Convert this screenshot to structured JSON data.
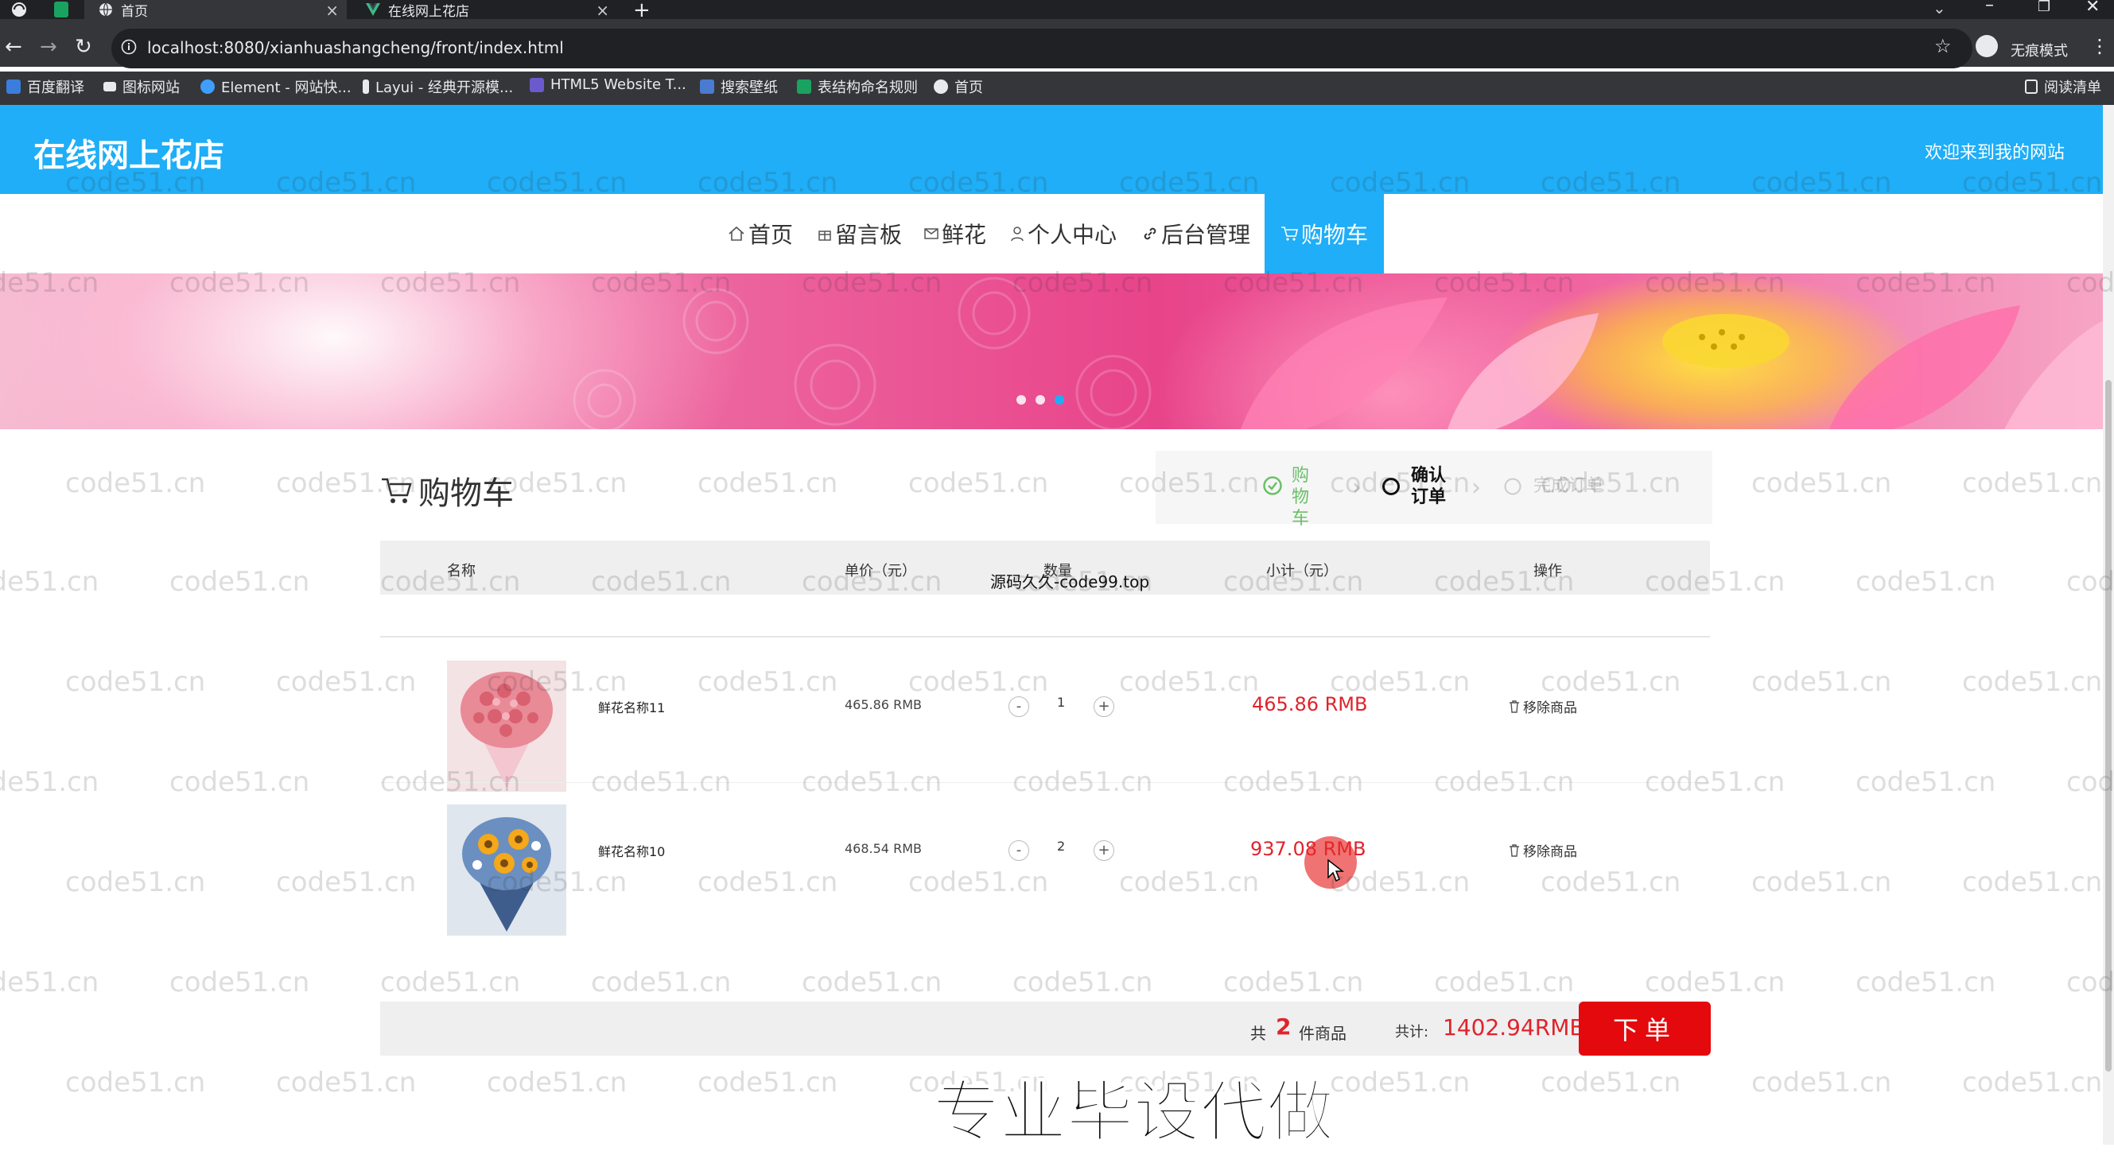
{
  "browser": {
    "tabs": [
      {
        "label": "首页",
        "icon": "globe-icon"
      },
      {
        "label": "在线网上花店",
        "icon": "vue-logo-icon"
      }
    ],
    "new_tab": "+",
    "url": "localhost:8080/xianhuashangcheng/front/index.html",
    "profile_label": "无痕模式",
    "bookmarks": [
      "百度翻译",
      "图标网站",
      "Element - 网站快...",
      "Layui - 经典开源模...",
      "HTML5 Website T...",
      "搜索壁纸",
      "表结构命名规则",
      "首页"
    ],
    "reading_list": "阅读清单",
    "colors": {
      "titlebar": "#202124",
      "toolbar": "#35363a"
    }
  },
  "site": {
    "title": "在线网上花店",
    "welcome": "欢迎来到我的网站",
    "accent_color": "#1faef7"
  },
  "nav": [
    {
      "label": "首页",
      "icon": "home-icon",
      "active": false
    },
    {
      "label": "留言板",
      "icon": "gift-icon",
      "active": false
    },
    {
      "label": "鲜花",
      "icon": "mail-icon",
      "active": false
    },
    {
      "label": "个人中心",
      "icon": "user-icon",
      "active": false
    },
    {
      "label": "后台管理",
      "icon": "link-icon",
      "active": false
    },
    {
      "label": "购物车",
      "icon": "cart-icon",
      "active": true
    }
  ],
  "banner": {
    "slide_count": 3,
    "active_slide": 3
  },
  "cart": {
    "title": "购物车",
    "steps": [
      {
        "label": "购物车",
        "state": "done"
      },
      {
        "label": "确认订单",
        "state": "current"
      },
      {
        "label": "完成订单",
        "state": "pending"
      }
    ],
    "headers": {
      "name": "名称",
      "price": "单价（元）",
      "qty": "数量",
      "subtotal": "小计（元）",
      "action": "操作"
    },
    "items": [
      {
        "name": "鲜花名称11",
        "price": "465.86 RMB",
        "qty": "1",
        "subtotal": "465.86 RMB",
        "remove": "移除商品",
        "image": "pink-roses-bouquet"
      },
      {
        "name": "鲜花名称10",
        "price": "468.54 RMB",
        "qty": "2",
        "subtotal": "937.08 RMB",
        "remove": "移除商品",
        "image": "sunflower-bouquet"
      }
    ],
    "minus": "-",
    "plus": "+",
    "summary": {
      "count_prefix": "共",
      "count": "2",
      "count_suffix": "件商品",
      "total_label": "共计:",
      "total": "1402.94RMB"
    },
    "order_button": "下单",
    "price_color": "#e0232c"
  },
  "overlays": {
    "watermark": "code51.cn",
    "source_text": "源码久久-code99.top",
    "promo": "专业毕设代做"
  }
}
